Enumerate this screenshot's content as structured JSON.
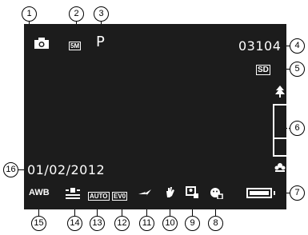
{
  "screen": {
    "shot_counter": "03104",
    "date": "01/02/2012",
    "program_mode_label": "P",
    "resolution_label": "5M",
    "storage_label": "SD",
    "status_icons": {
      "awb_label": "AWB",
      "auto_label": "AUTO",
      "ev_label": "EV0"
    }
  },
  "callouts": [
    "1",
    "2",
    "3",
    "4",
    "5",
    "6",
    "7",
    "8",
    "9",
    "10",
    "11",
    "12",
    "13",
    "14",
    "15",
    "16"
  ],
  "colors": {
    "screen_bg": "#1c1c1c",
    "osd": "#ffffff",
    "callout_line": "#000000"
  }
}
